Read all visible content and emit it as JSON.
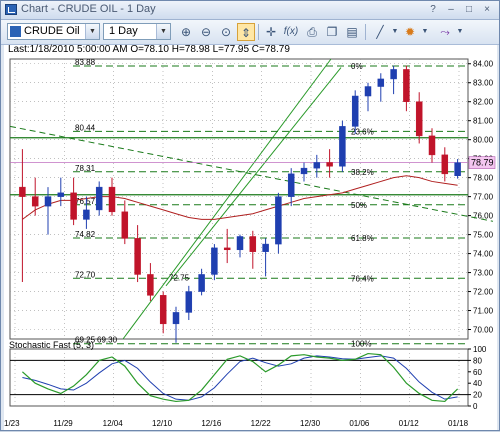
{
  "window": {
    "title": "Chart - CRUDE OIL - 1 Day",
    "buttons": [
      "?",
      "–",
      "□",
      "×"
    ]
  },
  "toolbar": {
    "symbol": "CRUDE Oil",
    "period": "1 Day",
    "dropdown_glyph": "▼",
    "icons": [
      "zoom-in-icon",
      "zoom-out-icon",
      "zoom-fit-icon",
      "crosshair-icon",
      "fibonacci-icon",
      "print-icon",
      "copy-icon",
      "save-icon",
      "line-draw-icon",
      "indicator-icon",
      "annotation-icon"
    ]
  },
  "info_line": "Last:1/18/2010 5:00:00 AM O=78.10 H=78.98 L=77.95 C=78.79",
  "indicator_label": "Stochastic Fast (5, 3)",
  "colors": {
    "up_candle": "#1f3fb0",
    "down_candle": "#c0142a",
    "fib_line": "#1a7a1a",
    "trend_line": "#2a9a2a",
    "ma_red": "#b02020",
    "current_price_bg": "#f4c6f0",
    "grid": "#9a9a9a"
  },
  "chart_data": {
    "type": "candlestick",
    "price_axis": {
      "min": 69.5,
      "max": 84.25,
      "ticks": [
        "84.00",
        "83.00",
        "82.00",
        "81.00",
        "80.00",
        "79.00",
        "78.00",
        "77.00",
        "76.00",
        "75.00",
        "74.00",
        "73.00",
        "72.00",
        "71.00",
        "70.00"
      ],
      "current": "78.79"
    },
    "x_tick_labels": [
      "1/23",
      "11/29",
      "12/04",
      "12/10",
      "12/16",
      "12/22",
      "12/30",
      "01/06",
      "01/12",
      "01/18"
    ],
    "candles": [
      {
        "o": 77.5,
        "h": 79.5,
        "l": 72.5,
        "c": 77.0
      },
      {
        "o": 77.0,
        "h": 78.0,
        "l": 76.0,
        "c": 76.5
      },
      {
        "o": 76.5,
        "h": 77.5,
        "l": 75.0,
        "c": 77.0
      },
      {
        "o": 77.0,
        "h": 78.0,
        "l": 76.5,
        "c": 77.2
      },
      {
        "o": 77.2,
        "h": 78.0,
        "l": 75.5,
        "c": 75.8
      },
      {
        "o": 75.8,
        "h": 77.0,
        "l": 75.3,
        "c": 76.3
      },
      {
        "o": 76.3,
        "h": 77.8,
        "l": 76.0,
        "c": 77.5
      },
      {
        "o": 77.5,
        "h": 78.0,
        "l": 76.0,
        "c": 76.2
      },
      {
        "o": 76.2,
        "h": 76.8,
        "l": 74.5,
        "c": 74.8
      },
      {
        "o": 74.8,
        "h": 75.5,
        "l": 72.5,
        "c": 72.9
      },
      {
        "o": 72.9,
        "h": 73.5,
        "l": 71.5,
        "c": 71.8
      },
      {
        "o": 71.8,
        "h": 72.0,
        "l": 69.8,
        "c": 70.3
      },
      {
        "o": 70.3,
        "h": 71.2,
        "l": 69.3,
        "c": 70.9
      },
      {
        "o": 70.9,
        "h": 72.3,
        "l": 70.5,
        "c": 72.0
      },
      {
        "o": 72.0,
        "h": 73.2,
        "l": 71.8,
        "c": 72.9
      },
      {
        "o": 72.9,
        "h": 74.5,
        "l": 72.6,
        "c": 74.3
      },
      {
        "o": 74.3,
        "h": 75.3,
        "l": 73.5,
        "c": 74.2
      },
      {
        "o": 74.2,
        "h": 75.0,
        "l": 73.8,
        "c": 74.9
      },
      {
        "o": 74.9,
        "h": 75.2,
        "l": 73.2,
        "c": 74.1
      },
      {
        "o": 74.1,
        "h": 74.8,
        "l": 72.8,
        "c": 74.5
      },
      {
        "o": 74.5,
        "h": 77.2,
        "l": 74.0,
        "c": 77.0
      },
      {
        "o": 77.0,
        "h": 78.5,
        "l": 76.5,
        "c": 78.2
      },
      {
        "o": 78.2,
        "h": 78.8,
        "l": 77.8,
        "c": 78.5
      },
      {
        "o": 78.5,
        "h": 79.2,
        "l": 78.0,
        "c": 78.8
      },
      {
        "o": 78.8,
        "h": 79.5,
        "l": 78.0,
        "c": 78.6
      },
      {
        "o": 78.6,
        "h": 81.0,
        "l": 78.3,
        "c": 80.7
      },
      {
        "o": 80.7,
        "h": 82.6,
        "l": 80.3,
        "c": 82.3
      },
      {
        "o": 82.3,
        "h": 83.0,
        "l": 81.5,
        "c": 82.8
      },
      {
        "o": 82.8,
        "h": 83.5,
        "l": 82.0,
        "c": 83.2
      },
      {
        "o": 83.2,
        "h": 83.9,
        "l": 82.4,
        "c": 83.7
      },
      {
        "o": 83.7,
        "h": 83.9,
        "l": 81.5,
        "c": 82.0
      },
      {
        "o": 82.0,
        "h": 82.5,
        "l": 79.8,
        "c": 80.2
      },
      {
        "o": 80.2,
        "h": 80.6,
        "l": 78.8,
        "c": 79.2
      },
      {
        "o": 79.2,
        "h": 79.6,
        "l": 77.8,
        "c": 78.2
      },
      {
        "o": 78.1,
        "h": 78.98,
        "l": 77.95,
        "c": 78.79
      }
    ],
    "ma_red": [
      75.8,
      76.3,
      76.6,
      76.8,
      76.8,
      76.9,
      77.0,
      77.0,
      76.9,
      76.7,
      76.5,
      76.3,
      76.1,
      75.9,
      75.8,
      75.8,
      75.9,
      76.0,
      76.1,
      76.3,
      76.5,
      76.7,
      76.9,
      77.0,
      77.1,
      77.2,
      77.4,
      77.6,
      77.8,
      78.0,
      78.1,
      78.0,
      77.8,
      77.7,
      77.6
    ],
    "fibonacci": [
      {
        "pct": "0%",
        "price": "83.88",
        "level": 83.88
      },
      {
        "pct": "23.6%",
        "price": "80.44",
        "level": 80.44
      },
      {
        "pct": "38.2%",
        "price": "78.31",
        "level": 78.31
      },
      {
        "pct": "50%",
        "price": "76.57",
        "level": 76.57
      },
      {
        "pct": "61.8%",
        "price": "74.82",
        "level": 74.82
      },
      {
        "pct": "76.4%",
        "price": "72.70",
        "level": 72.7
      },
      {
        "pct": "100%",
        "price": "69.25",
        "level": 69.25
      }
    ],
    "extra_labels": [
      "69.30",
      "72.75"
    ],
    "stochastic": {
      "axis_ticks": [
        "100",
        "80",
        "60",
        "40",
        "20",
        "0"
      ],
      "k": [
        60,
        40,
        30,
        22,
        35,
        55,
        80,
        86,
        70,
        40,
        18,
        12,
        8,
        10,
        28,
        55,
        82,
        88,
        78,
        60,
        72,
        88,
        90,
        86,
        84,
        80,
        82,
        92,
        90,
        68,
        40,
        22,
        10,
        8,
        30
      ],
      "d": [
        50,
        45,
        38,
        30,
        28,
        40,
        58,
        74,
        80,
        66,
        42,
        22,
        12,
        10,
        16,
        32,
        56,
        78,
        84,
        76,
        70,
        74,
        84,
        88,
        86,
        83,
        82,
        85,
        88,
        84,
        66,
        42,
        24,
        12,
        16
      ]
    }
  }
}
